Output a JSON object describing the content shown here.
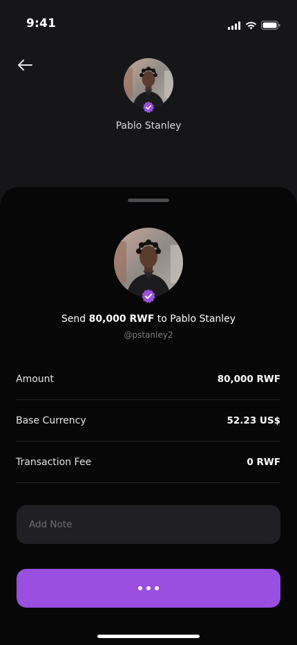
{
  "status_bar": {
    "time": "9:41",
    "icons": [
      "signal-icon",
      "wifi-icon",
      "battery-icon"
    ]
  },
  "header": {
    "back_icon": "arrow-left-icon",
    "name": "Pablo Stanley",
    "verified_icon": "verified-badge-icon"
  },
  "sheet": {
    "send_prefix": "Send ",
    "send_amount": "80,000 RWF",
    "send_middle": " to ",
    "send_recipient": "Pablo Stanley",
    "handle": "@pstanley2",
    "rows": [
      {
        "label": "Amount",
        "value": "80,000 RWF"
      },
      {
        "label": "Base Currency",
        "value": "52.23 US$"
      },
      {
        "label": "Transaction Fee",
        "value": "0 RWF"
      }
    ],
    "note_placeholder": "Add Note",
    "note_value": "",
    "action_icon": "loading-dots-icon"
  },
  "colors": {
    "accent": "#9a4fe0",
    "background": "#161618",
    "sheet": "#070707",
    "field": "#202024"
  }
}
